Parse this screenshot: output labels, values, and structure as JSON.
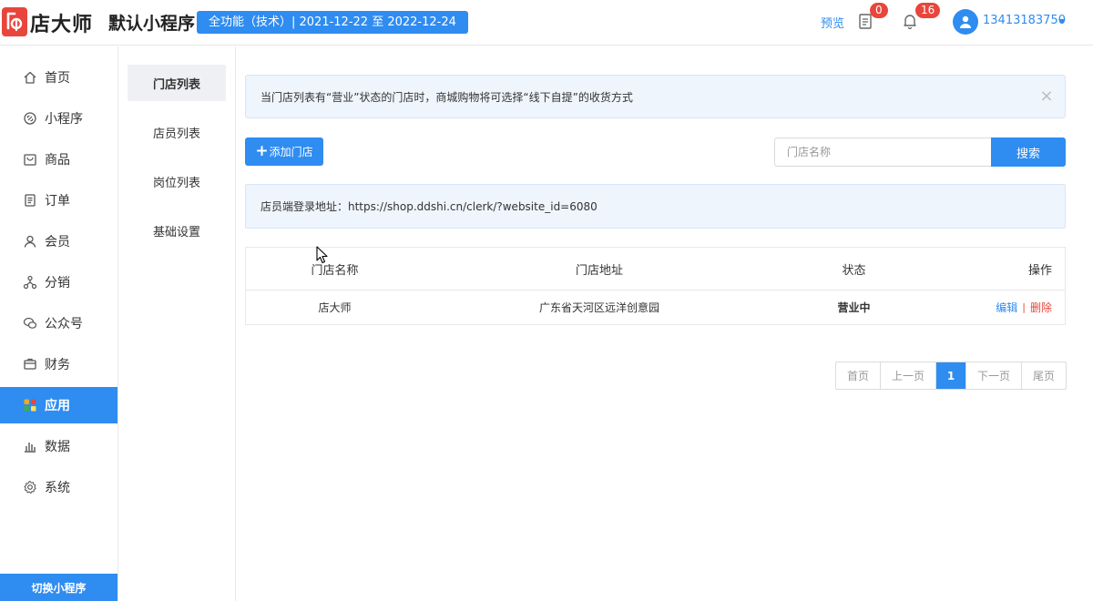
{
  "header": {
    "logo_text": "店大师",
    "app_name": "默认小程序",
    "plan_badge": "全功能（技术）| 2021-12-22 至 2022-12-24",
    "preview": "预览",
    "orders_count": "0",
    "notifications_count": "16",
    "user_phone": "13413183750"
  },
  "sidebar": {
    "items": [
      {
        "label": "首页",
        "icon": "home-icon"
      },
      {
        "label": "小程序",
        "icon": "link-icon"
      },
      {
        "label": "商品",
        "icon": "goods-icon"
      },
      {
        "label": "订单",
        "icon": "order-icon"
      },
      {
        "label": "会员",
        "icon": "user-icon"
      },
      {
        "label": "分销",
        "icon": "distribution-icon"
      },
      {
        "label": "公众号",
        "icon": "wechat-icon"
      },
      {
        "label": "财务",
        "icon": "finance-icon"
      },
      {
        "label": "应用",
        "icon": "apps-icon"
      },
      {
        "label": "数据",
        "icon": "chart-icon"
      },
      {
        "label": "系统",
        "icon": "gear-icon"
      }
    ],
    "active_index": 8,
    "switch_button": "切换小程序"
  },
  "subnav": {
    "items": [
      "门店列表",
      "店员列表",
      "岗位列表",
      "基础设置"
    ],
    "active_index": 0
  },
  "notice": {
    "text": "当门店列表有“营业”状态的门店时，商城购物将可选择“线下自提”的收货方式"
  },
  "toolbar": {
    "add_store": "添加门店",
    "search_placeholder": "门店名称",
    "search_button": "搜索"
  },
  "login_url": {
    "text": "店员端登录地址：https://shop.ddshi.cn/clerk/?website_id=6080"
  },
  "table": {
    "headers": [
      "门店名称",
      "门店地址",
      "状态",
      "操作"
    ],
    "rows": [
      {
        "name": "店大师",
        "address": "广东省天河区远洋创意园",
        "status": "营业中",
        "edit": "编辑",
        "delete": "删除"
      }
    ]
  },
  "pagination": {
    "first": "首页",
    "prev": "上一页",
    "current": "1",
    "next": "下一页",
    "last": "尾页"
  },
  "colors": {
    "primary": "#2f8cf0",
    "danger": "#e8453c",
    "success": "#3fae49"
  }
}
